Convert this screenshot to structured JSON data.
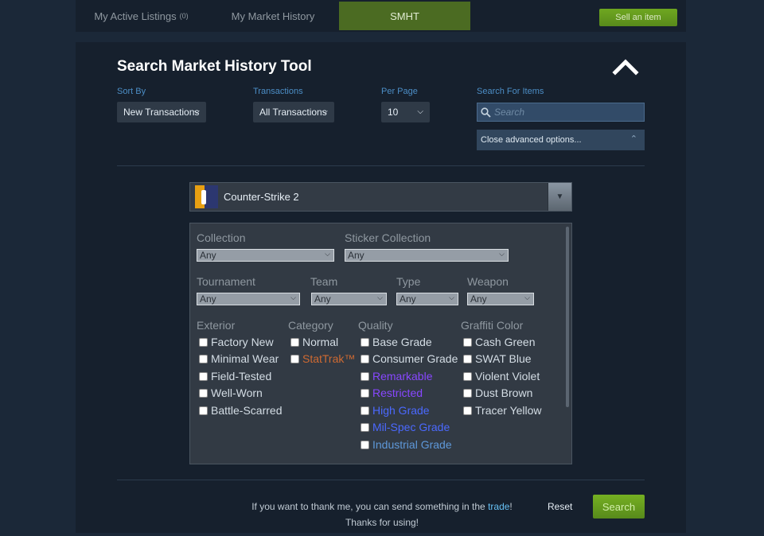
{
  "tabs": {
    "active_listings": "My Active Listings",
    "active_listings_count": "(0)",
    "market_history": "My Market History",
    "smht": "SMHT"
  },
  "sell_button": "Sell an item",
  "panel": {
    "title": "Search Market History Tool",
    "sort_by": {
      "label": "Sort By",
      "value": "New Transactions"
    },
    "transactions": {
      "label": "Transactions",
      "value": "All Transactions"
    },
    "per_page": {
      "label": "Per Page",
      "value": "10"
    },
    "search": {
      "label": "Search For Items",
      "placeholder": "Search"
    },
    "advanced_options": "Close advanced options..."
  },
  "game": {
    "name": "Counter-Strike 2"
  },
  "filters": {
    "collection": {
      "label": "Collection",
      "value": "Any"
    },
    "sticker_collection": {
      "label": "Sticker Collection",
      "value": "Any"
    },
    "tournament": {
      "label": "Tournament",
      "value": "Any"
    },
    "team": {
      "label": "Team",
      "value": "Any"
    },
    "type": {
      "label": "Type",
      "value": "Any"
    },
    "weapon": {
      "label": "Weapon",
      "value": "Any"
    },
    "exterior": {
      "label": "Exterior",
      "options": [
        "Factory New",
        "Minimal Wear",
        "Field-Tested",
        "Well-Worn",
        "Battle-Scarred"
      ]
    },
    "category": {
      "label": "Category",
      "options": [
        {
          "text": "Normal",
          "color": "#d4dde5"
        },
        {
          "text": "StatTrak™",
          "color": "#cf6a32"
        }
      ]
    },
    "quality": {
      "label": "Quality",
      "options": [
        {
          "text": "Base Grade",
          "color": "#d4dde5"
        },
        {
          "text": "Consumer Grade",
          "color": "#d4dde5"
        },
        {
          "text": "Remarkable",
          "color": "#8847ff"
        },
        {
          "text": "Restricted",
          "color": "#8847ff"
        },
        {
          "text": "High Grade",
          "color": "#4b69ff"
        },
        {
          "text": "Mil-Spec Grade",
          "color": "#4b69ff"
        },
        {
          "text": "Industrial Grade",
          "color": "#5e98d9"
        }
      ]
    },
    "graffiti_color": {
      "label": "Graffiti Color",
      "options": [
        "Cash Green",
        "SWAT Blue",
        "Violent Violet",
        "Dust Brown",
        "Tracer Yellow"
      ]
    }
  },
  "footer": {
    "thanks_prefix": "If you want to thank me, you can send something in the ",
    "thanks_link": "trade",
    "thanks_suffix": "!",
    "thanks_line2": "Thanks for using!",
    "reset": "Reset",
    "search": "Search"
  }
}
